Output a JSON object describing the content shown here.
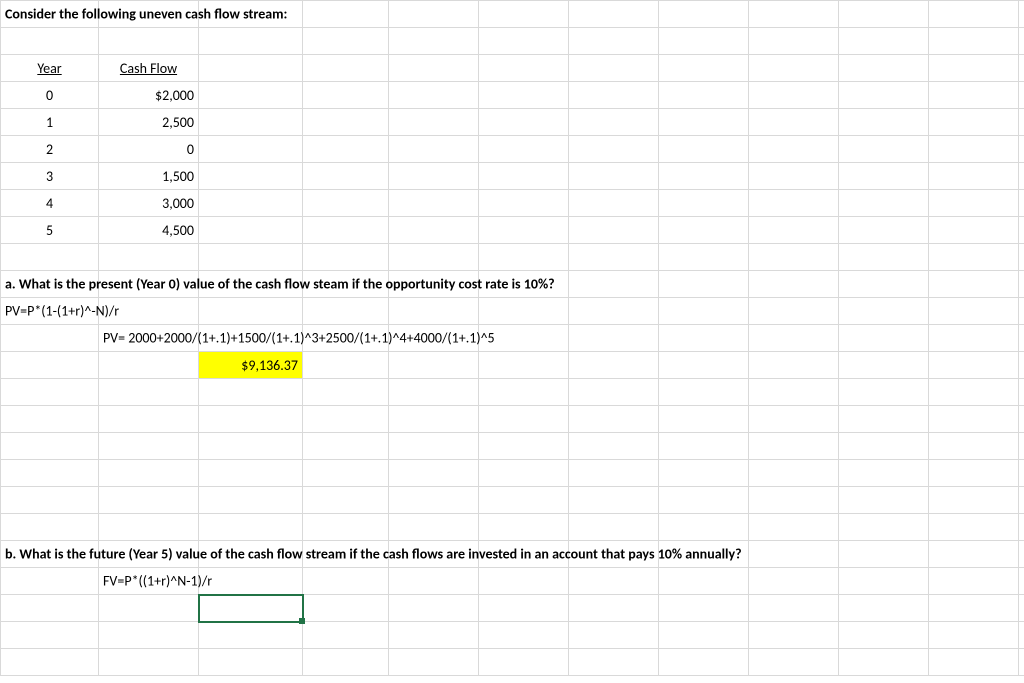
{
  "title": "Consider the following uneven cash flow stream:",
  "headers": {
    "year": "Year",
    "cashflow": "Cash Flow"
  },
  "rows": [
    {
      "year": "0",
      "cf": "$2,000"
    },
    {
      "year": "1",
      "cf": "2,500"
    },
    {
      "year": "2",
      "cf": "0"
    },
    {
      "year": "3",
      "cf": "1,500"
    },
    {
      "year": "4",
      "cf": "3,000"
    },
    {
      "year": "5",
      "cf": "4,500"
    }
  ],
  "qa": {
    "prompt": "a. What is the present (Year 0) value of the cash flow steam if the opportunity cost rate is 10%?",
    "formula_general": "PV=P*(1-(1+r)^-N)/r",
    "formula_expanded": "PV= 2000+2000/(1+.1)+1500/(1+.1)^3+2500/(1+.1)^4+4000/(1+.1)^5",
    "result": "$9,136.37"
  },
  "qb": {
    "prompt": "b. What is the future (Year 5) value of the cash flow stream if the cash flows are invested in an account that pays 10% annually?",
    "formula_general": "FV=P*((1+r)^N-1)/r"
  }
}
